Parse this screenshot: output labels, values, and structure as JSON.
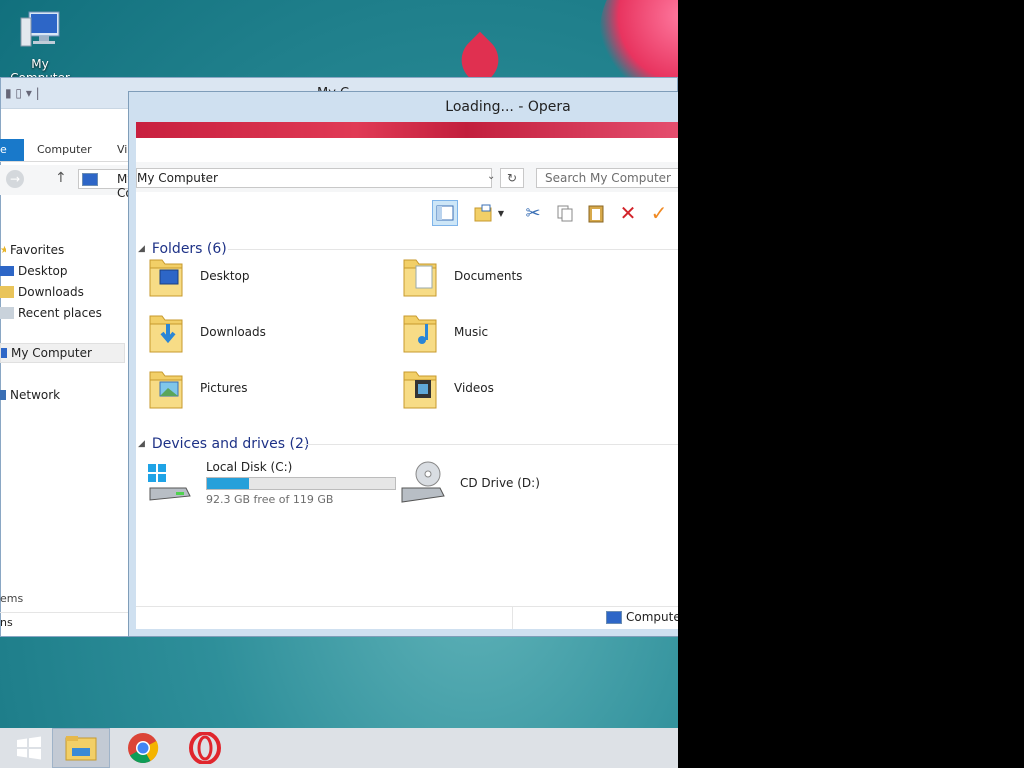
{
  "desktop": {
    "icon_label": "My Computer"
  },
  "bg_window": {
    "title_partial": "My C",
    "ribbon_tabs": [
      "e",
      "Computer",
      "View"
    ],
    "address_partial": "My Computer",
    "favorites_label": "Favorites",
    "favorites": [
      "Desktop",
      "Downloads",
      "Recent places"
    ],
    "my_computer": "My Computer",
    "network": "Network",
    "items_partial": "ems",
    "status_partial": "ns"
  },
  "fg_window": {
    "title": "Loading... - Opera",
    "address": {
      "root": "My Computer"
    },
    "search_placeholder": "Search My Computer",
    "folders_group": "Folders (6)",
    "folders": [
      {
        "name": "Desktop",
        "icon": "desktop-folder-icon"
      },
      {
        "name": "Documents",
        "icon": "documents-folder-icon"
      },
      {
        "name": "Downloads",
        "icon": "downloads-folder-icon"
      },
      {
        "name": "Music",
        "icon": "music-folder-icon"
      },
      {
        "name": "Pictures",
        "icon": "pictures-folder-icon"
      },
      {
        "name": "Videos",
        "icon": "videos-folder-icon"
      }
    ],
    "devices_group": "Devices and drives (2)",
    "local_disk": {
      "name": "Local Disk (C:)",
      "free_text": "92.3 GB free of 119 GB",
      "used_fraction": 0.224
    },
    "cd_drive": {
      "name": "CD Drive (D:)"
    },
    "status_right": "Computer"
  },
  "taskbar": {
    "apps": [
      "windows-start-icon",
      "file-explorer-icon",
      "chrome-icon",
      "opera-icon"
    ]
  },
  "colors": {
    "accent": "#1979ca",
    "drive_fill": "#26a0da",
    "group_header": "#1e3287"
  }
}
